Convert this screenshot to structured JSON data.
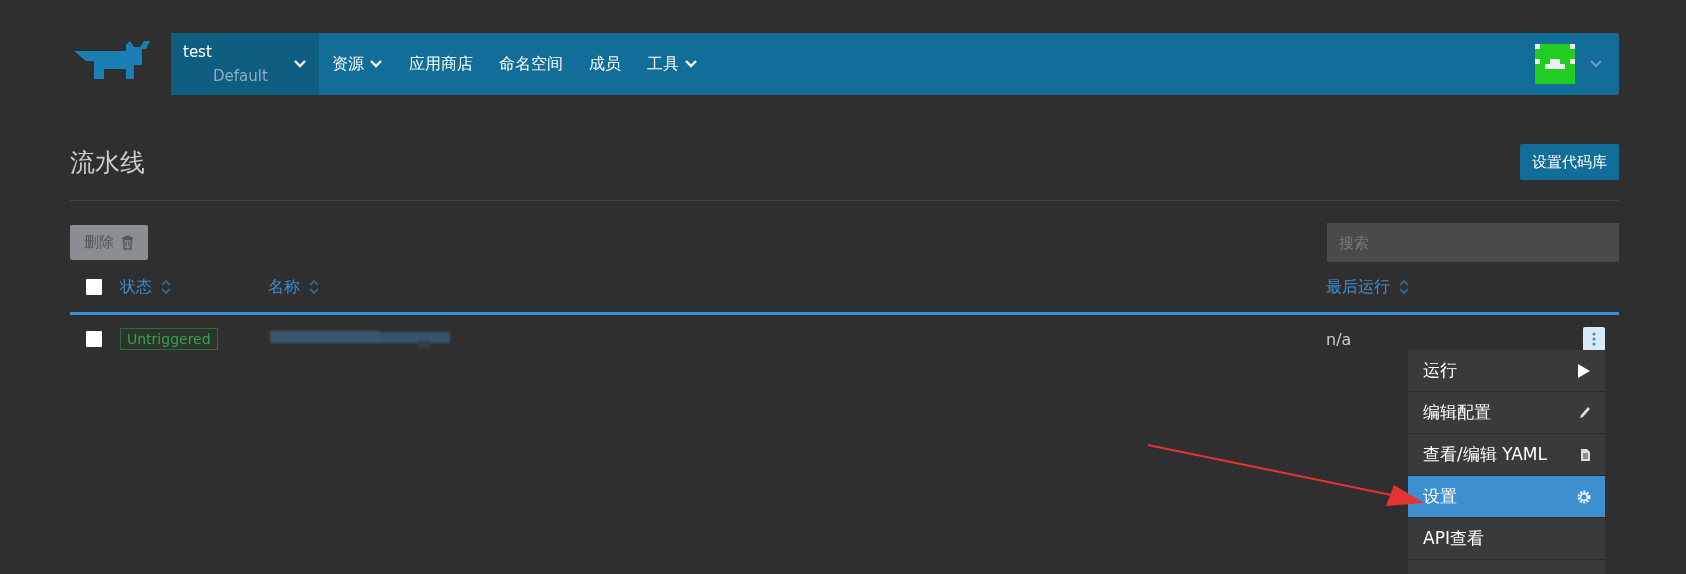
{
  "header": {
    "cluster": {
      "name": "test",
      "project": "Default"
    },
    "nav": [
      {
        "label": "资源",
        "dropdown": true
      },
      {
        "label": "应用商店",
        "dropdown": false
      },
      {
        "label": "命名空间",
        "dropdown": false
      },
      {
        "label": "成员",
        "dropdown": false
      },
      {
        "label": "工具",
        "dropdown": true
      }
    ]
  },
  "page": {
    "title": "流水线",
    "primary_button": "设置代码库"
  },
  "toolbar": {
    "delete_button": "删除",
    "delete_disabled": true,
    "search": {
      "placeholder": "搜索"
    }
  },
  "table": {
    "select_all_checked": false,
    "columns": [
      {
        "label": "状态",
        "kind": "status"
      },
      {
        "label": "名称",
        "kind": "name"
      },
      {
        "label": "最后运行",
        "kind": "last"
      }
    ],
    "rows": [
      {
        "checked": false,
        "status": "Untriggered",
        "last_run": "n/a"
      }
    ]
  },
  "menu": {
    "items": [
      {
        "label": "运行",
        "kind": "play",
        "selected": false
      },
      {
        "label": "编辑配置",
        "kind": "pencil",
        "selected": false
      },
      {
        "label": "查看/编辑 YAML",
        "kind": "file",
        "selected": false
      },
      {
        "label": "设置",
        "kind": "gear",
        "selected": true
      },
      {
        "label": "API查看",
        "kind": "none",
        "selected": false
      }
    ]
  }
}
